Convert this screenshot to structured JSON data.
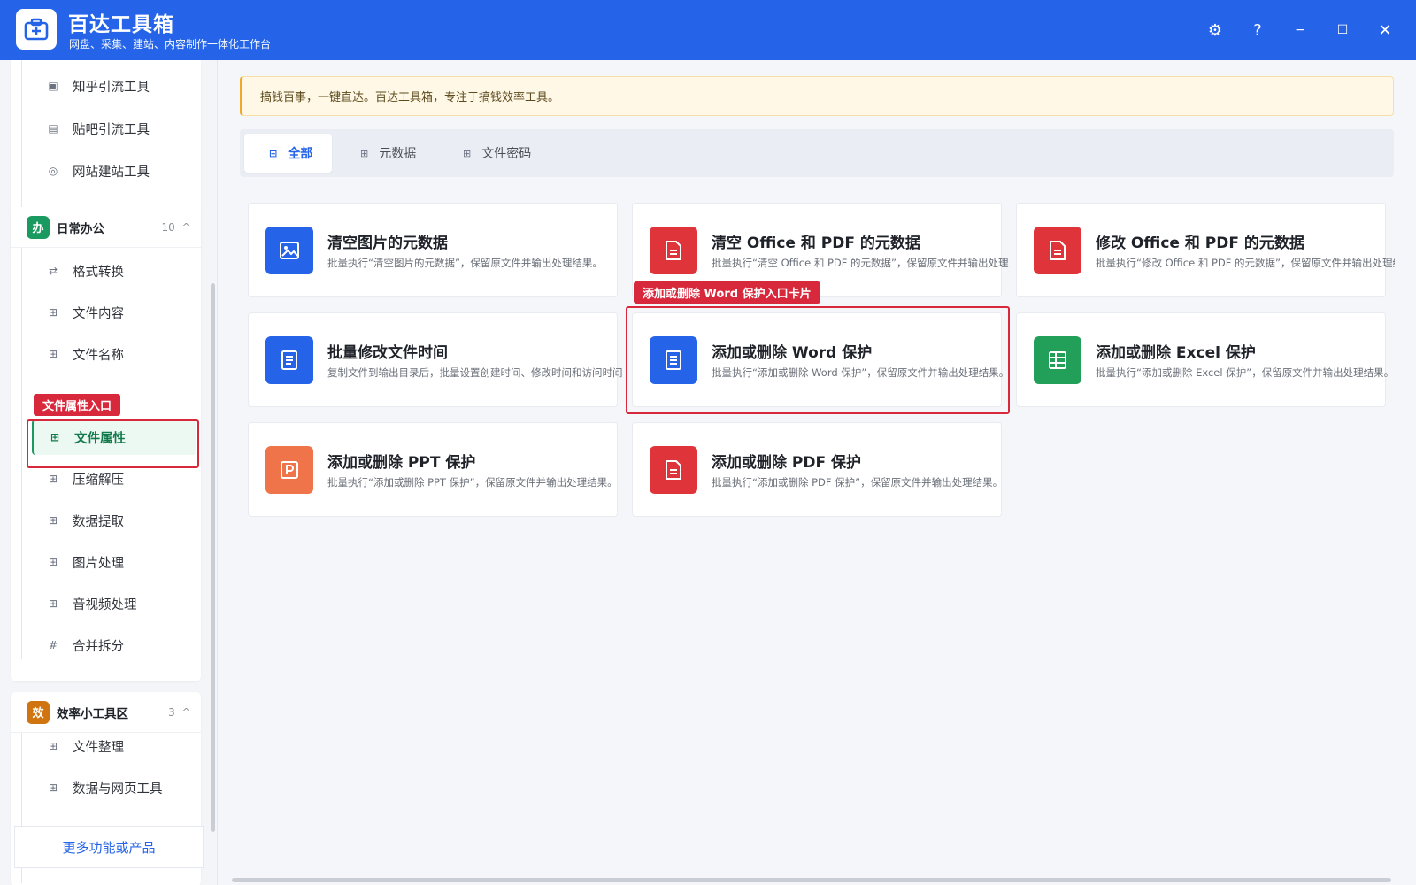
{
  "app": {
    "title": "百达工具箱",
    "subtitle": "网盘、采集、建站、内容制作一体化工作台"
  },
  "window_controls": {
    "settings": "⚙",
    "help": "?",
    "minimize": "−",
    "maximize": "☐",
    "close": "✕"
  },
  "sidebar": {
    "top_items": [
      {
        "label": "知乎引流工具",
        "icon": "zhihu-icon"
      },
      {
        "label": "贴吧引流工具",
        "icon": "tieba-icon"
      },
      {
        "label": "网站建站工具",
        "icon": "site-icon"
      }
    ],
    "group_office": {
      "badge": "办",
      "title": "日常办公",
      "count": "10",
      "caret": "^",
      "color": "#1a9a5e",
      "items": [
        {
          "label": "格式转换",
          "icon": "⇄"
        },
        {
          "label": "文件内容",
          "icon": "grid"
        },
        {
          "label": "文件名称",
          "icon": "grid"
        },
        {
          "label": "文件属性",
          "icon": "grid",
          "active": true
        },
        {
          "label": "压缩解压",
          "icon": "grid"
        },
        {
          "label": "数据提取",
          "icon": "grid"
        },
        {
          "label": "图片处理",
          "icon": "grid"
        },
        {
          "label": "音视频处理",
          "icon": "grid"
        },
        {
          "label": "合并拆分",
          "icon": "#"
        }
      ]
    },
    "group_efficiency": {
      "badge": "效",
      "title": "效率小工具区",
      "count": "3",
      "caret": "^",
      "color": "#e07b16",
      "items": [
        {
          "label": "文件整理",
          "icon": "grid"
        },
        {
          "label": "数据与网页工具",
          "icon": "grid"
        }
      ]
    },
    "more_label": "更多功能或产品"
  },
  "notice": "搞钱百事，一键直达。百达工具箱，专注于搞钱效率工具。",
  "tabs": [
    {
      "label": "全部",
      "active": true
    },
    {
      "label": "元数据"
    },
    {
      "label": "文件密码"
    }
  ],
  "cards": [
    {
      "title": "清空图片的元数据",
      "desc": "批量执行“清空图片的元数据”，保留原文件并输出处理结果。",
      "icon": "image-icon",
      "color": "#2564e8"
    },
    {
      "title": "清空 Office 和 PDF 的元数据",
      "desc": "批量执行“清空 Office 和 PDF 的元数据”，保留原文件并输出处理",
      "icon": "document-icon",
      "color": "#e0343b"
    },
    {
      "title": "修改 Office 和 PDF 的元数据",
      "desc": "批量执行“修改 Office 和 PDF 的元数据”，保留原文件并输出处理结",
      "icon": "document-icon",
      "color": "#e0343b"
    },
    {
      "title": "批量修改文件时间",
      "desc": "复制文件到输出目录后，批量设置创建时间、修改时间和访问时间",
      "icon": "file-lines-icon",
      "color": "#2564e8"
    },
    {
      "title": "添加或删除 Word 保护",
      "desc": "批量执行“添加或删除 Word 保护”，保留原文件并输出处理结果。",
      "icon": "word-icon",
      "color": "#2564e8"
    },
    {
      "title": "添加或删除 Excel 保护",
      "desc": "批量执行“添加或删除 Excel 保护”，保留原文件并输出处理结果。",
      "icon": "excel-icon",
      "color": "#22a05a"
    },
    {
      "title": "添加或删除 PPT 保护",
      "desc": "批量执行“添加或删除 PPT 保护”，保留原文件并输出处理结果。",
      "icon": "ppt-icon",
      "color": "#f0744a"
    },
    {
      "title": "添加或删除 PDF 保护",
      "desc": "批量执行“添加或删除 PDF 保护”，保留原文件并输出处理结果。",
      "icon": "pdf-icon",
      "color": "#e0343b"
    }
  ],
  "annotations": {
    "sidebar_label": "文件属性入口",
    "card_label": "添加或删除 Word 保护入口卡片"
  }
}
